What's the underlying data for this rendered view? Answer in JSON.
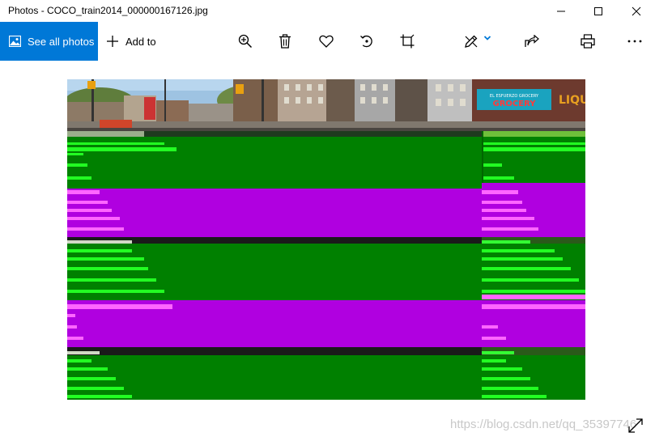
{
  "window": {
    "title": "Photos - COCO_train2014_000000167126.jpg",
    "controls": [
      "minimize-icon",
      "maximize-icon",
      "close-icon"
    ]
  },
  "toolbar": {
    "see_all_label": "See all photos",
    "add_to_label": "Add to",
    "icons": [
      "zoom-in-icon",
      "delete-icon",
      "favorite-heart-icon",
      "rotate-icon",
      "crop-icon",
      "edit-pen-icon",
      "share-icon",
      "print-icon",
      "more-icon"
    ],
    "accent_color": "#0078d7"
  },
  "photo": {
    "shop_sign": "EL ESFUERZO GROCERY",
    "shop_sign_side": "LIQU",
    "glitch_colors": {
      "green": "#008000",
      "magenta": "#b000e0",
      "lime": "#22ff22",
      "pink": "#ff66ff"
    }
  },
  "watermark": "https://blog.csdn.net/qq_35397746"
}
